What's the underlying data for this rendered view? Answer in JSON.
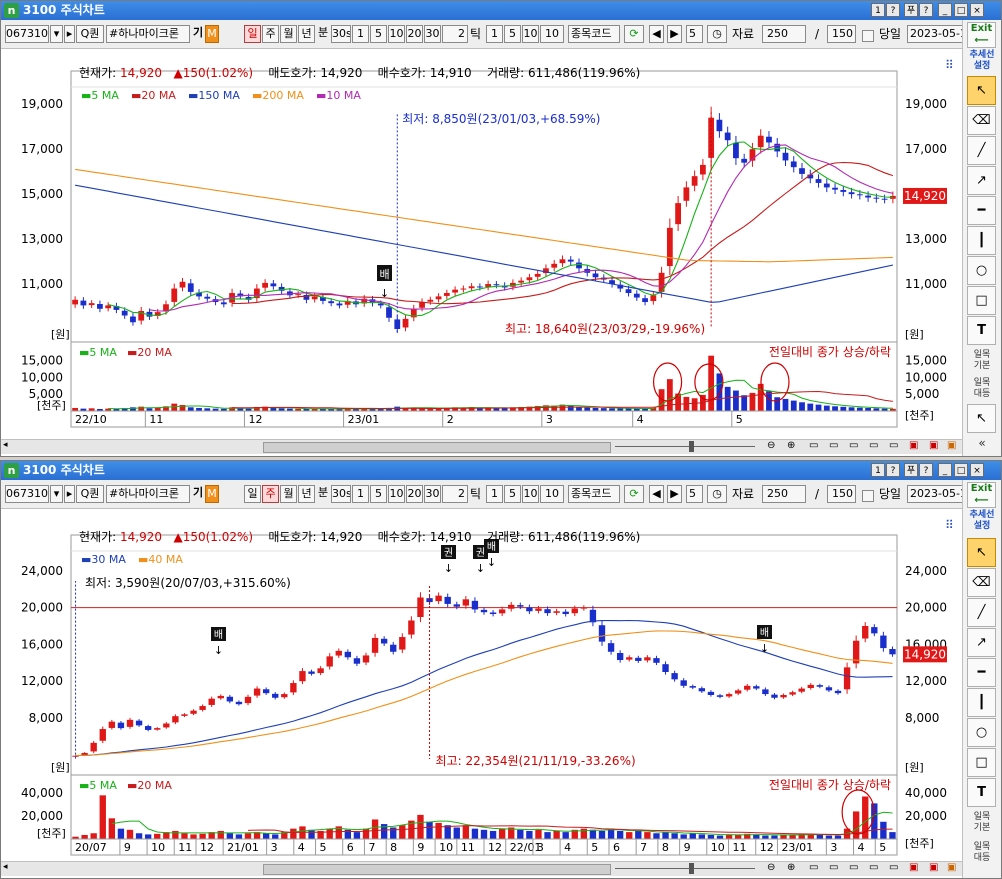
{
  "app_title": "3100 주식차트",
  "window_buttons": [
    "1",
    "?",
    "푸",
    "?",
    "×"
  ],
  "toolbar": {
    "code": "067310",
    "name": "#하나마이크론",
    "name_suffix": "기",
    "m_badge": "M",
    "search_glyph": "Q",
    "search_label": "퀀",
    "periods": [
      "일",
      "주",
      "월",
      "년",
      "분"
    ],
    "minute_opts": [
      "30s",
      "1",
      "5",
      "10",
      "20",
      "30"
    ],
    "tick_value": "2",
    "tick_label": "틱",
    "tick_opts": [
      "1",
      "5",
      "10",
      "10"
    ],
    "code_input": "종목코드",
    "step_value": "5",
    "data_label": "자료",
    "data_count": "250",
    "slash": "/",
    "total_count": "150",
    "today_label": "당일",
    "date_value": "2023-05-1"
  },
  "right_toolbar": {
    "exit": "Exit",
    "trend_label": "추세선 설정",
    "daily_basic": "일목 기본",
    "daily_vs": "일목 대등"
  },
  "info_bar": {
    "current_label": "현재가:",
    "current_value": "14,920",
    "change_value": "150(1.02%)",
    "ask_label": "매도호가:",
    "ask_value": "14,920",
    "bid_label": "매수호가:",
    "bid_value": "14,910",
    "volume_label": "거래량:",
    "volume_value": "611,486(119.96%)"
  },
  "colors": {
    "up": "#e01818",
    "down": "#1a2ecc",
    "ma5": "#17b317",
    "ma20": "#c71c1c",
    "ma150": "#1f3fb5",
    "ma200": "#f0901a",
    "ma10": "#b22ab2",
    "ma30": "#1f3fb5",
    "ma40": "#f0901a"
  },
  "chart_data": [
    {
      "type": "line",
      "name": "daily-candlestick",
      "legend": [
        "5 MA",
        "20 MA",
        "150 MA",
        "200 MA",
        "10 MA"
      ],
      "price_axis": [
        "19,000",
        "17,000",
        "15,000",
        "13,000",
        "11,000"
      ],
      "price_unit": "[원]",
      "ylim": [
        9000,
        19500
      ],
      "current_tag": "14,920",
      "annotations": {
        "low": "최저: 8,850원(23/01/03,+68.59%)",
        "high": "최고: 18,640원(23/03/29,-19.96%)",
        "marker": "배"
      },
      "volume_legend": [
        "5 MA",
        "20 MA"
      ],
      "volume_axis": [
        "15,000",
        "10,000",
        "5,000"
      ],
      "volume_unit": "[천주]",
      "volume_note": "전일대비 종가 상승/하락",
      "volume_ylim": [
        0,
        17000
      ],
      "x_labels": [
        "22/10",
        "11",
        "12",
        "23/01",
        "2",
        "3",
        "4",
        "5"
      ],
      "closes": [
        10300,
        10050,
        10150,
        9900,
        10050,
        9850,
        9600,
        9300,
        9800,
        9550,
        9750,
        10100,
        10800,
        11100,
        10650,
        10450,
        10350,
        10200,
        10100,
        10600,
        10450,
        10300,
        10800,
        11050,
        10900,
        10700,
        10500,
        10550,
        10300,
        10450,
        10250,
        10150,
        10050,
        10250,
        10100,
        10350,
        10150,
        10050,
        9500,
        9000,
        9450,
        9900,
        10200,
        10300,
        10450,
        10600,
        10750,
        10800,
        10900,
        10850,
        11000,
        10950,
        10850,
        11050,
        11150,
        11300,
        11450,
        11700,
        11900,
        12100,
        12000,
        11700,
        11500,
        11300,
        11200,
        11000,
        10800,
        10600,
        10400,
        10200,
        10500,
        11500,
        13500,
        14600,
        15300,
        15800,
        16300,
        18400,
        17800,
        17400,
        16600,
        16400,
        17000,
        17600,
        17300,
        16900,
        16500,
        16200,
        15900,
        15700,
        15500,
        15300,
        15200,
        15100,
        15000,
        14950,
        14850,
        14800,
        14770,
        14920
      ],
      "vols": [
        900,
        700,
        800,
        600,
        700,
        650,
        900,
        1100,
        1300,
        800,
        900,
        1400,
        2200,
        1800,
        1100,
        900,
        800,
        700,
        650,
        1100,
        850,
        700,
        1200,
        1300,
        900,
        800,
        700,
        650,
        600,
        650,
        700,
        600,
        550,
        650,
        600,
        750,
        650,
        600,
        900,
        1300,
        1000,
        900,
        850,
        800,
        900,
        1000,
        1100,
        900,
        1200,
        800,
        1000,
        900,
        850,
        1100,
        1200,
        1300,
        1500,
        1700,
        1600,
        1900,
        1500,
        1200,
        1000,
        900,
        850,
        800,
        750,
        800,
        700,
        650,
        900,
        6500,
        9500,
        5200,
        4200,
        3800,
        4800,
        16500,
        11200,
        7200,
        6100,
        4700,
        5400,
        8100,
        5900,
        4100,
        3600,
        3100,
        2600,
        2200,
        1900,
        1600,
        1400,
        1250,
        1100,
        1000,
        900,
        800,
        700,
        650
      ]
    },
    {
      "type": "line",
      "name": "weekly-candlestick",
      "legend": [
        "30 MA",
        "40 MA"
      ],
      "price_axis": [
        "24,000",
        "20,000",
        "16,000",
        "12,000",
        "8,000"
      ],
      "price_unit": "[원]",
      "ylim": [
        3000,
        25500
      ],
      "current_tag": "14,920",
      "annotations": {
        "low": "최저: 3,590원(20/07/03,+315.60%)",
        "high": "최고: 22,354원(21/11/19,-33.26%)",
        "markers": [
          "배",
          "권",
          "권",
          "배",
          "배"
        ]
      },
      "volume_legend": [
        "5 MA",
        "20 MA"
      ],
      "volume_axis": [
        "40,000",
        "20,000"
      ],
      "volume_unit": "[천주]",
      "volume_note": "전일대비 종가 상승/하락",
      "volume_ylim": [
        0,
        47000
      ],
      "x_labels": [
        "20/07",
        "9",
        "10",
        "11",
        "12",
        "21/01",
        "3",
        "4",
        "5",
        "6",
        "7",
        "8",
        "9",
        "10",
        "11",
        "12",
        "22/01",
        "3",
        "4",
        "5",
        "6",
        "7",
        "8",
        "9",
        "10",
        "11",
        "12",
        "23/01",
        "3",
        "4",
        "5"
      ],
      "closes": [
        3900,
        4200,
        5300,
        6800,
        7600,
        6900,
        7800,
        7200,
        6700,
        6900,
        7400,
        8200,
        8400,
        8800,
        9300,
        10100,
        10400,
        9800,
        9500,
        10300,
        11200,
        10700,
        10200,
        10600,
        11800,
        13100,
        12800,
        13400,
        14700,
        15300,
        14600,
        13900,
        14800,
        16700,
        16100,
        15200,
        16800,
        18600,
        21100,
        20600,
        21300,
        20400,
        20100,
        20900,
        19800,
        19500,
        19300,
        19800,
        20300,
        20100,
        19600,
        19900,
        19400,
        19600,
        19300,
        19900,
        20000,
        18400,
        16300,
        15200,
        14300,
        14600,
        14200,
        14600,
        14000,
        13000,
        12200,
        11500,
        11300,
        10900,
        10500,
        10300,
        10600,
        11000,
        11500,
        11200,
        10600,
        10200,
        10500,
        10800,
        11200,
        11600,
        11400,
        11000,
        10700,
        13500,
        16400,
        18000,
        17200,
        15600,
        14920
      ],
      "vols": [
        2000,
        3500,
        5000,
        38000,
        18000,
        9000,
        8000,
        5000,
        4000,
        4500,
        6000,
        7000,
        5000,
        4000,
        4500,
        6000,
        7000,
        5000,
        4000,
        5000,
        6000,
        5000,
        4000,
        6000,
        9000,
        11000,
        8000,
        7000,
        9000,
        11000,
        8000,
        6000,
        9000,
        17000,
        13000,
        10000,
        12000,
        16000,
        21000,
        15000,
        14000,
        12000,
        10000,
        12000,
        9000,
        8000,
        7000,
        9000,
        10000,
        8000,
        7000,
        8000,
        6000,
        7000,
        6000,
        8000,
        9000,
        8000,
        7000,
        9000,
        7000,
        6000,
        7000,
        6000,
        5000,
        6000,
        5000,
        4000,
        5000,
        4000,
        3500,
        3000,
        3500,
        4000,
        4500,
        4000,
        3000,
        3000,
        3500,
        4000,
        4500,
        4000,
        3500,
        3000,
        3000,
        9000,
        24000,
        37000,
        31000,
        15000,
        6000
      ]
    }
  ]
}
